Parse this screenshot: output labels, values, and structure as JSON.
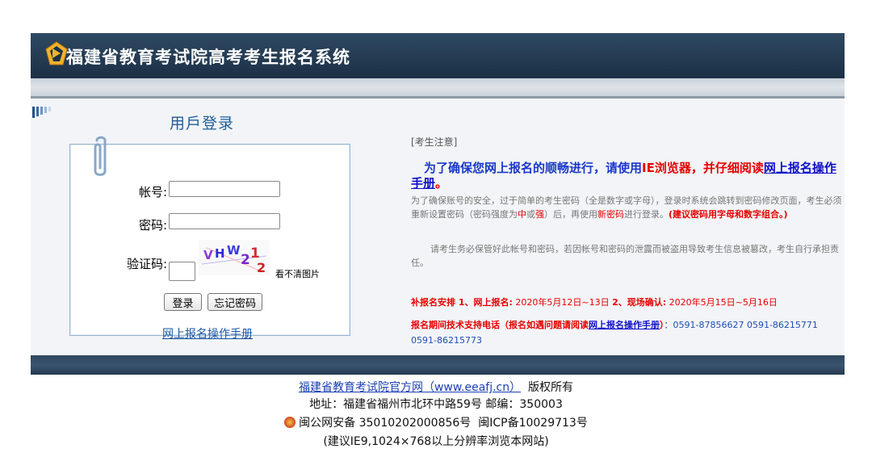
{
  "header": {
    "title": "福建省教育考试院高考考生报名系统"
  },
  "login": {
    "title": "用戶登录",
    "account_label": "帐号:",
    "password_label": "密码:",
    "captcha_label": "验证码:",
    "captcha_text": "VHW21",
    "captcha_refresh": "看不清图片",
    "login_button": "登录",
    "forgot_button": "忘记密码",
    "manual_link": "网上报名操作手册"
  },
  "notice": {
    "heading": "[考生注意]",
    "main_prefix": "为了确保您网上报名的顺畅进行，请使用",
    "main_ie": "IE浏览器，",
    "main_mid": "并仔细阅读",
    "main_link": "网上报名操作手册",
    "main_end": "。",
    "p1_a": "为了确保账号的安全，过于简单的考生密码（全是数字或字母），登录时系统会跳转到密码修改页面，考生必须重新设置密码（密码强度为",
    "p1_zhong": "中",
    "p1_or": "或",
    "p1_qiang": "强",
    "p1_b": "）后，再使用",
    "p1_new": "新密码",
    "p1_c": "进行登录。",
    "p1_tip": "(建议密码用字母和数字组合。)",
    "p2": "请考生务必保管好此帐号和密码，若因帐号和密码的泄露而被盗用导致考生信息被篡改，考生自行承担责任。",
    "sched_label": "补报名安排 1、网上报名:",
    "sched_1": " 2020年5月12日~13日 ",
    "sched_2_label": "2、现场确认:",
    "sched_2": " 2020年5月15日~5月16日",
    "support_label": "报名期间技术支持电话（报名如遇问题请阅读",
    "support_link": "网上报名操作手册",
    "support_close": "）",
    "support_phones": "：0591-87856627  0591-86215771  0591-86215773"
  },
  "footer": {
    "site_link": "福建省教育考试院官方网（www.eeafj.cn）",
    "copyright": "版权所有",
    "address": "地址：福建省福州市北环中路59号 邮编：350003",
    "police_record": "闽公网安备 35010202000856号",
    "icp": "闽ICP备10029713号",
    "browser_tip": "(建议IE9,1024×768以上分辨率浏览本网站)"
  },
  "colors": {
    "header_bg": "#243b52",
    "link": "#1a55a4",
    "alert": "#e60000"
  },
  "icons": [
    "logo-icon",
    "paperclip-icon",
    "police-badge-icon"
  ]
}
